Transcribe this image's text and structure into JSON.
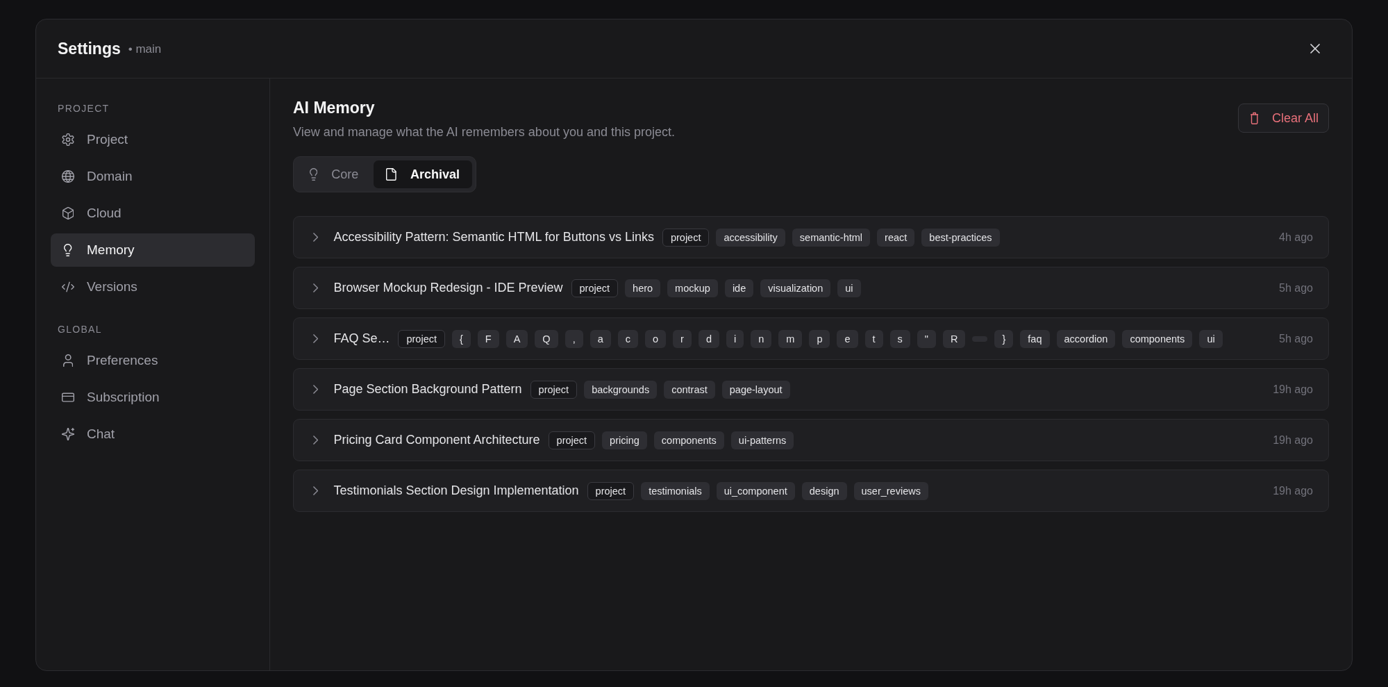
{
  "window": {
    "title": "Settings",
    "subtitle": "• main"
  },
  "sidebar": {
    "sections": [
      {
        "heading": "PROJECT",
        "items": [
          {
            "label": "Project",
            "selected": false
          },
          {
            "label": "Domain",
            "selected": false
          },
          {
            "label": "Cloud",
            "selected": false
          },
          {
            "label": "Memory",
            "selected": true
          },
          {
            "label": "Versions",
            "selected": false
          }
        ]
      },
      {
        "heading": "GLOBAL",
        "items": [
          {
            "label": "Preferences",
            "selected": false
          },
          {
            "label": "Subscription",
            "selected": false
          },
          {
            "label": "Chat",
            "selected": false
          }
        ]
      }
    ]
  },
  "main": {
    "title": "AI Memory",
    "description": "View and manage what the AI remembers about you and this project.",
    "clear_button": "Clear All",
    "tabs": [
      {
        "label": "Core",
        "selected": false
      },
      {
        "label": "Archival",
        "selected": true
      }
    ],
    "memories": [
      {
        "title": "Accessibility Pattern: Semantic HTML for Buttons vs Links",
        "expanded": false,
        "tags": [
          {
            "kind": "scope",
            "label": "project"
          },
          {
            "kind": "topic",
            "label": "accessibility"
          },
          {
            "kind": "topic",
            "label": "semantic-html"
          },
          {
            "kind": "topic",
            "label": "react"
          },
          {
            "kind": "topic",
            "label": "best-practices"
          }
        ],
        "time": "4h ago"
      },
      {
        "title": "Browser Mockup Redesign - IDE Preview",
        "expanded": false,
        "tags": [
          {
            "kind": "scope",
            "label": "project"
          },
          {
            "kind": "topic",
            "label": "hero"
          },
          {
            "kind": "topic",
            "label": "mockup"
          },
          {
            "kind": "topic",
            "label": "ide"
          },
          {
            "kind": "topic",
            "label": "visualization"
          },
          {
            "kind": "topic",
            "label": "ui"
          }
        ],
        "time": "5h ago"
      },
      {
        "title": "FAQ Se…",
        "expanded": false,
        "tags": [
          {
            "kind": "scope",
            "label": "project"
          },
          {
            "kind": "topic",
            "label": "{"
          },
          {
            "kind": "topic",
            "label": "F"
          },
          {
            "kind": "topic",
            "label": "A"
          },
          {
            "kind": "topic",
            "label": "Q"
          },
          {
            "kind": "topic",
            "label": ","
          },
          {
            "kind": "topic",
            "label": "a"
          },
          {
            "kind": "topic",
            "label": "c"
          },
          {
            "kind": "topic",
            "label": "o"
          },
          {
            "kind": "topic",
            "label": "r"
          },
          {
            "kind": "topic",
            "label": "d"
          },
          {
            "kind": "topic",
            "label": "i"
          },
          {
            "kind": "topic",
            "label": "n"
          },
          {
            "kind": "topic",
            "label": "m"
          },
          {
            "kind": "topic",
            "label": "p"
          },
          {
            "kind": "topic",
            "label": "e"
          },
          {
            "kind": "topic",
            "label": "t"
          },
          {
            "kind": "topic",
            "label": "s"
          },
          {
            "kind": "topic",
            "label": "\""
          },
          {
            "kind": "topic",
            "label": "R"
          },
          {
            "kind": "blank"
          },
          {
            "kind": "topic",
            "label": "}"
          },
          {
            "kind": "topic",
            "label": "faq"
          },
          {
            "kind": "topic",
            "label": "accordion"
          },
          {
            "kind": "topic",
            "label": "components"
          },
          {
            "kind": "topic",
            "label": "ui"
          }
        ],
        "time": "5h ago"
      },
      {
        "title": "Page Section Background Pattern",
        "expanded": false,
        "tags": [
          {
            "kind": "scope",
            "label": "project"
          },
          {
            "kind": "topic",
            "label": "backgrounds"
          },
          {
            "kind": "topic",
            "label": "contrast"
          },
          {
            "kind": "topic",
            "label": "page-layout"
          }
        ],
        "time": "19h ago"
      },
      {
        "title": "Pricing Card Component Architecture",
        "expanded": false,
        "tags": [
          {
            "kind": "scope",
            "label": "project"
          },
          {
            "kind": "topic",
            "label": "pricing"
          },
          {
            "kind": "topic",
            "label": "components"
          },
          {
            "kind": "topic",
            "label": "ui-patterns"
          }
        ],
        "time": "19h ago"
      },
      {
        "title": "Testimonials Section Design Implementation",
        "expanded": false,
        "tags": [
          {
            "kind": "scope",
            "label": "project"
          },
          {
            "kind": "topic",
            "label": "testimonials"
          },
          {
            "kind": "topic",
            "label": "ui_component"
          },
          {
            "kind": "topic",
            "label": "design"
          },
          {
            "kind": "topic",
            "label": "user_reviews"
          }
        ],
        "time": "19h ago"
      }
    ]
  }
}
